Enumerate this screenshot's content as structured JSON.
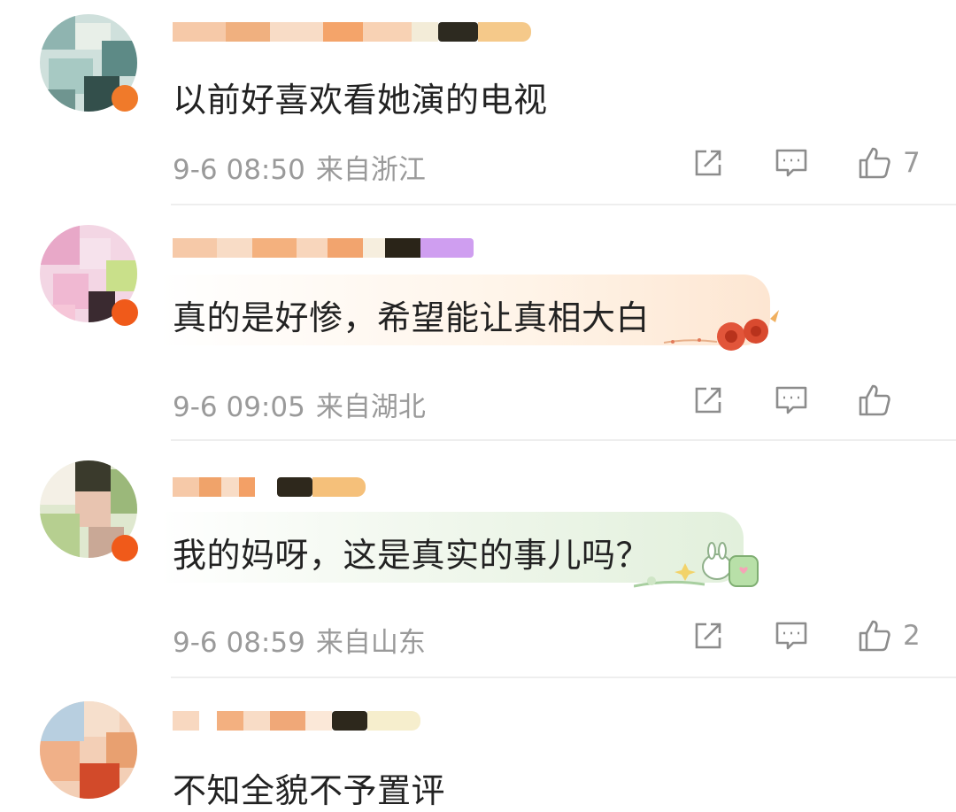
{
  "comments": [
    {
      "text": "以前好喜欢看她演的电视",
      "date": "9-6 08:50",
      "location": "来自浙江",
      "likes": "7"
    },
    {
      "text": "真的是好惨，希望能让真相大白",
      "date": "9-6 09:05",
      "location": "来自湖北",
      "likes": ""
    },
    {
      "text": "我的妈呀，这是真实的事儿吗？",
      "date": "9-6 08:59",
      "location": "来自山东",
      "likes": "2"
    },
    {
      "text": "不知全貌不予置评",
      "date": "",
      "location": "",
      "likes": ""
    }
  ],
  "icons": {
    "repost": "share-arrow-icon",
    "comment": "comment-bubble-icon",
    "like": "thumbs-up-icon"
  },
  "colors": {
    "text": "#222222",
    "meta": "#9a9a9a",
    "divider": "#eeeeee"
  }
}
